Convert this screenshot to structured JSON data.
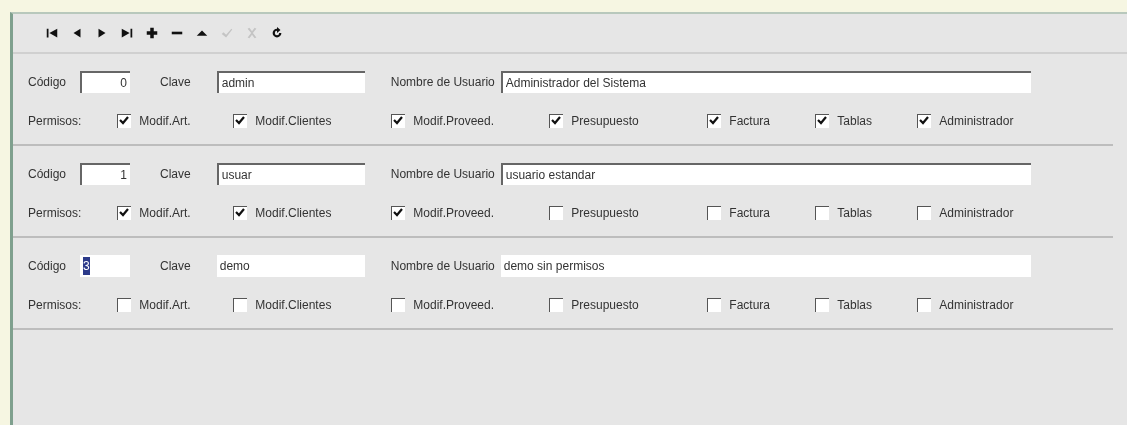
{
  "toolbar": [
    {
      "kind": "first",
      "disabled": false
    },
    {
      "kind": "prior",
      "disabled": false
    },
    {
      "kind": "next",
      "disabled": false
    },
    {
      "kind": "last",
      "disabled": false
    },
    {
      "kind": "insert",
      "disabled": false
    },
    {
      "kind": "delete",
      "disabled": false
    },
    {
      "kind": "edit",
      "disabled": false
    },
    {
      "kind": "post",
      "disabled": true
    },
    {
      "kind": "cancel",
      "disabled": true
    },
    {
      "kind": "refresh",
      "disabled": false
    }
  ],
  "records": [
    {
      "active": false,
      "codigo_label": "Código",
      "codigo": "0",
      "clave_label": "Clave",
      "clave": "admin",
      "nombre_label": "Nombre de Usuario",
      "nombre": "Administrador del Sistema",
      "permisos_label": "Permisos:",
      "permisos": [
        {
          "label": "Modif.Art.",
          "checked": true
        },
        {
          "label": "Modif.Clientes",
          "checked": true
        },
        {
          "label": "Modif.Proveed.",
          "checked": true
        },
        {
          "label": "Presupuesto",
          "checked": true
        },
        {
          "label": "Factura",
          "checked": true
        },
        {
          "label": "Tablas",
          "checked": true
        },
        {
          "label": "Administrador",
          "checked": true
        }
      ]
    },
    {
      "active": false,
      "codigo_label": "Código",
      "codigo": "1",
      "clave_label": "Clave",
      "clave": "usuar",
      "nombre_label": "Nombre de Usuario",
      "nombre": "usuario estandar",
      "permisos_label": "Permisos:",
      "permisos": [
        {
          "label": "Modif.Art.",
          "checked": true
        },
        {
          "label": "Modif.Clientes",
          "checked": true
        },
        {
          "label": "Modif.Proveed.",
          "checked": true
        },
        {
          "label": "Presupuesto",
          "checked": false
        },
        {
          "label": "Factura",
          "checked": false
        },
        {
          "label": "Tablas",
          "checked": false
        },
        {
          "label": "Administrador",
          "checked": false
        }
      ]
    },
    {
      "active": true,
      "codigo_label": "Código",
      "codigo": "3",
      "clave_label": "Clave",
      "clave": "demo",
      "nombre_label": "Nombre de Usuario",
      "nombre": "demo sin permisos",
      "permisos_label": "Permisos:",
      "permisos": [
        {
          "label": "Modif.Art.",
          "checked": false
        },
        {
          "label": "Modif.Clientes",
          "checked": false
        },
        {
          "label": "Modif.Proveed.",
          "checked": false
        },
        {
          "label": "Presupuesto",
          "checked": false
        },
        {
          "label": "Factura",
          "checked": false
        },
        {
          "label": "Tablas",
          "checked": false
        },
        {
          "label": "Administrador",
          "checked": false
        }
      ]
    }
  ]
}
